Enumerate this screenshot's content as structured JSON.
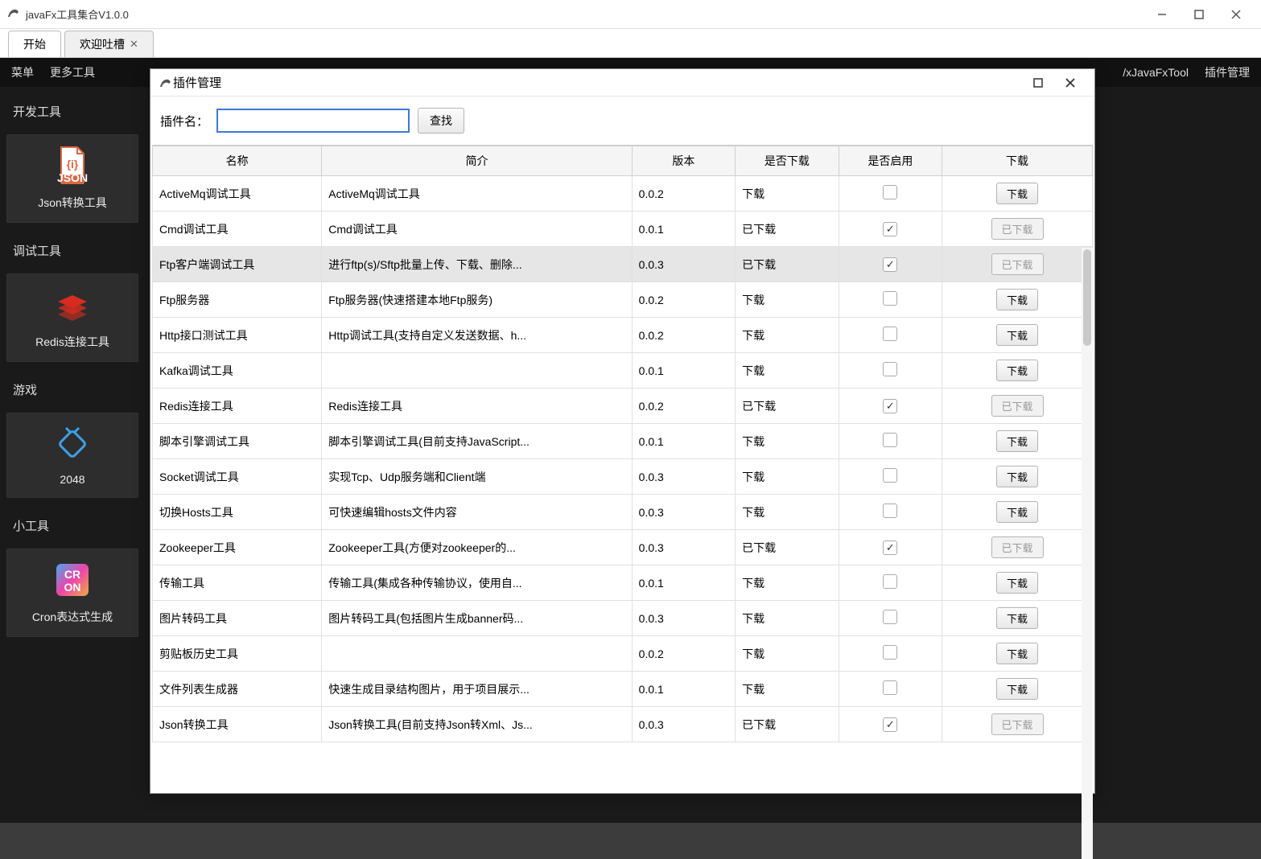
{
  "mainWindow": {
    "title": "javaFx工具集合V1.0.0",
    "tabs": [
      {
        "label": "开始",
        "closable": false
      },
      {
        "label": "欢迎吐槽",
        "closable": true
      }
    ],
    "menubar": {
      "menu": "菜单",
      "moreTools": "更多工具",
      "rightLink": "/xJavaFxTool",
      "pluginMgr": "插件管理"
    },
    "sidebar": {
      "sections": [
        {
          "title": "开发工具",
          "tiles": [
            {
              "label": "Json转换工具",
              "iconType": "json"
            }
          ]
        },
        {
          "title": "调试工具",
          "tiles": [
            {
              "label": "Redis连接工具",
              "iconType": "redis"
            }
          ]
        },
        {
          "title": "游戏",
          "tiles": [
            {
              "label": "2048",
              "iconType": "plug"
            }
          ]
        },
        {
          "title": "小工具",
          "tiles": [
            {
              "label": "Cron表达式生成",
              "iconType": "cron"
            }
          ]
        }
      ]
    }
  },
  "dialog": {
    "title": "插件管理",
    "searchLabel": "插件名：",
    "searchValue": "",
    "searchBtn": "查找",
    "columns": {
      "name": "名称",
      "desc": "简介",
      "version": "版本",
      "downloaded": "是否下载",
      "enabled": "是否启用",
      "action": "下载"
    },
    "downloadBtn": "下载",
    "downloadedBtn": "已下载",
    "rows": [
      {
        "name": "ActiveMq调试工具",
        "desc": "ActiveMq调试工具",
        "version": "0.0.2",
        "downloaded": "下载",
        "enabled": false,
        "hasDownloaded": false
      },
      {
        "name": "Cmd调试工具",
        "desc": "Cmd调试工具",
        "version": "0.0.1",
        "downloaded": "已下载",
        "enabled": true,
        "hasDownloaded": true
      },
      {
        "name": "Ftp客户端调试工具",
        "desc": "进行ftp(s)/Sftp批量上传、下载、删除...",
        "version": "0.0.3",
        "downloaded": "已下载",
        "enabled": true,
        "hasDownloaded": true,
        "hover": true
      },
      {
        "name": "Ftp服务器",
        "desc": "Ftp服务器(快速搭建本地Ftp服务)",
        "version": "0.0.2",
        "downloaded": "下载",
        "enabled": false,
        "hasDownloaded": false
      },
      {
        "name": "Http接口测试工具",
        "desc": "Http调试工具(支持自定义发送数据、h...",
        "version": "0.0.2",
        "downloaded": "下载",
        "enabled": false,
        "hasDownloaded": false
      },
      {
        "name": "Kafka调试工具",
        "desc": "",
        "version": "0.0.1",
        "downloaded": "下载",
        "enabled": false,
        "hasDownloaded": false
      },
      {
        "name": "Redis连接工具",
        "desc": "Redis连接工具",
        "version": "0.0.2",
        "downloaded": "已下载",
        "enabled": true,
        "hasDownloaded": true
      },
      {
        "name": "脚本引擎调试工具",
        "desc": "脚本引擎调试工具(目前支持JavaScript...",
        "version": "0.0.1",
        "downloaded": "下载",
        "enabled": false,
        "hasDownloaded": false
      },
      {
        "name": "Socket调试工具",
        "desc": "实现Tcp、Udp服务端和Client端",
        "version": "0.0.3",
        "downloaded": "下载",
        "enabled": false,
        "hasDownloaded": false
      },
      {
        "name": "切换Hosts工具",
        "desc": "可快速编辑hosts文件内容",
        "version": "0.0.3",
        "downloaded": "下载",
        "enabled": false,
        "hasDownloaded": false
      },
      {
        "name": "Zookeeper工具",
        "desc": "Zookeeper工具(方便对zookeeper的...",
        "version": "0.0.3",
        "downloaded": "已下载",
        "enabled": true,
        "hasDownloaded": true
      },
      {
        "name": "传输工具",
        "desc": "传输工具(集成各种传输协议，使用自...",
        "version": "0.0.1",
        "downloaded": "下载",
        "enabled": false,
        "hasDownloaded": false
      },
      {
        "name": "图片转码工具",
        "desc": "图片转码工具(包括图片生成banner码...",
        "version": "0.0.3",
        "downloaded": "下载",
        "enabled": false,
        "hasDownloaded": false
      },
      {
        "name": "剪贴板历史工具",
        "desc": "",
        "version": "0.0.2",
        "downloaded": "下载",
        "enabled": false,
        "hasDownloaded": false
      },
      {
        "name": "文件列表生成器",
        "desc": "快速生成目录结构图片，用于项目展示...",
        "version": "0.0.1",
        "downloaded": "下载",
        "enabled": false,
        "hasDownloaded": false
      },
      {
        "name": "Json转换工具",
        "desc": "Json转换工具(目前支持Json转Xml、Js...",
        "version": "0.0.3",
        "downloaded": "已下载",
        "enabled": true,
        "hasDownloaded": true
      }
    ]
  }
}
